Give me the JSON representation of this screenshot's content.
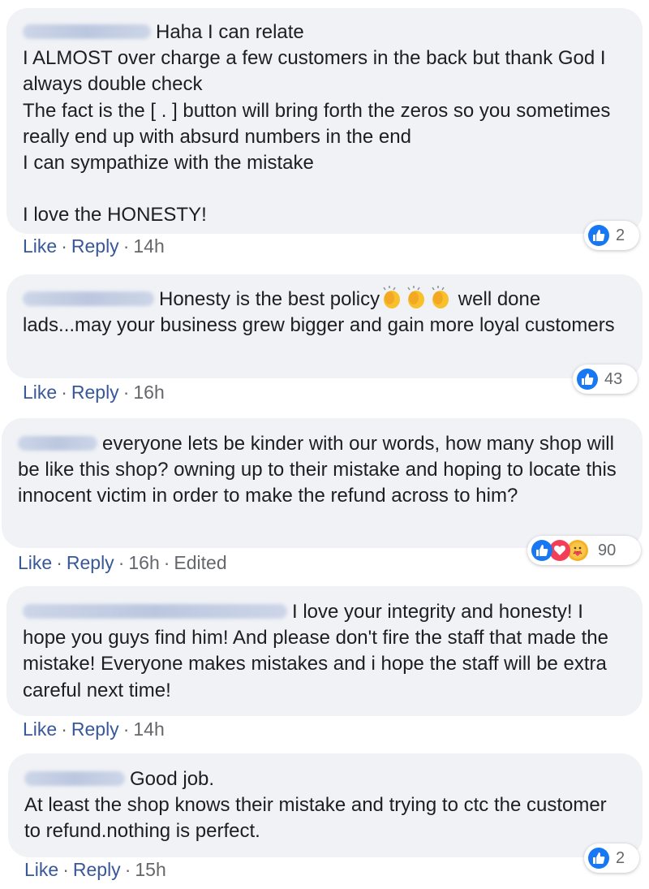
{
  "comments": [
    {
      "text": "Haha I can relate\nI ALMOST over charge a few customers in the back but thank God I always double check\nThe fact is the [ . ] button will bring forth the zeros so you sometimes really end up with absurd numbers in the end\nI can sympathize with the mistake\n\nI love the HONESTY!",
      "like": "Like",
      "reply": "Reply",
      "time": "14h",
      "reactions": "2"
    },
    {
      "text_a": "Honesty is the best policy",
      "text_b": " well done lads...may your business grew bigger and gain more loyal customers",
      "like": "Like",
      "reply": "Reply",
      "time": "16h",
      "reactions": "43"
    },
    {
      "text": "everyone lets be kinder with our words, how many shop will be like this shop? owning up to their mistake and hoping to locate this innocent victim in order to make the refund across to him?",
      "like": "Like",
      "reply": "Reply",
      "time": "16h",
      "edited": "Edited",
      "reactions": "90"
    },
    {
      "text": "I love your integrity and honesty! I hope you guys find him! And please don't fire the staff that made the mistake! Everyone makes mistakes and i hope the staff will be extra careful next time!",
      "like": "Like",
      "reply": "Reply",
      "time": "14h"
    },
    {
      "text": "Good job.\nAt least the shop knows their mistake and trying to ctc the customer to refund.nothing is perfect.",
      "like": "Like",
      "reply": "Reply",
      "time": "15h",
      "reactions": "2"
    }
  ],
  "icons": {
    "like": "like-icon",
    "love": "love-icon",
    "care": "care-icon",
    "clap": "clapping-hands-icon"
  },
  "colors": {
    "bubble": "#f0f2f5",
    "link": "#385898",
    "meta": "#65676b",
    "like": "#1877f2"
  }
}
